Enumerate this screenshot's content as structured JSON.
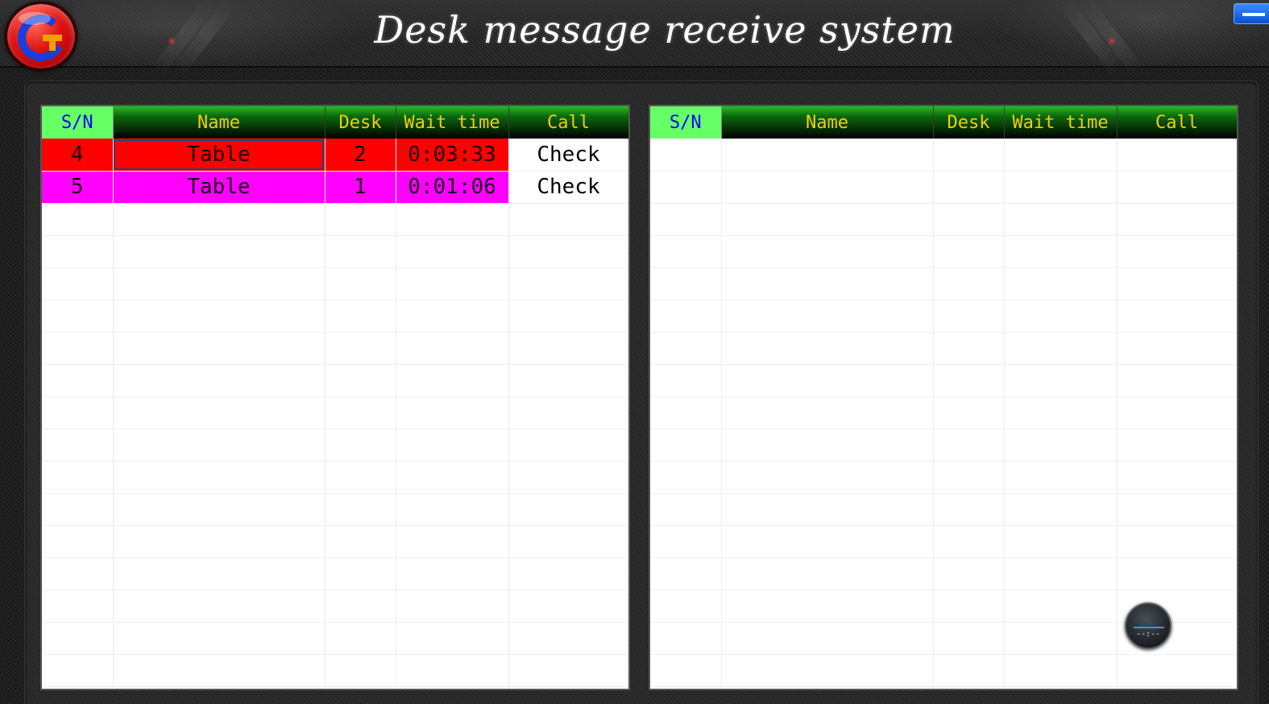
{
  "header": {
    "title": "Desk message receive system",
    "logo_letter": "G"
  },
  "colors": {
    "header_text": "#f0d000",
    "sn_header_bg": "#66ff66",
    "sn_header_text": "#0000ff",
    "row_alert_red": "#ff0000",
    "row_alert_magenta": "#ff00ff",
    "minimize_button": "#1a64e8"
  },
  "left_table": {
    "columns": [
      "S/N",
      "Name",
      "Desk",
      "Wait time",
      "Call"
    ],
    "rows": [
      {
        "sn": "4",
        "name": "Table",
        "desk": "2",
        "wait": "0:03:33",
        "call": "Check",
        "color": "red"
      },
      {
        "sn": "5",
        "name": "Table",
        "desk": "1",
        "wait": "0:01:06",
        "call": "Check",
        "color": "magenta"
      }
    ]
  },
  "right_table": {
    "columns": [
      "S/N",
      "Name",
      "Desk",
      "Wait time",
      "Call"
    ],
    "rows": []
  },
  "clock_widget": {
    "time_text": "--:--"
  }
}
